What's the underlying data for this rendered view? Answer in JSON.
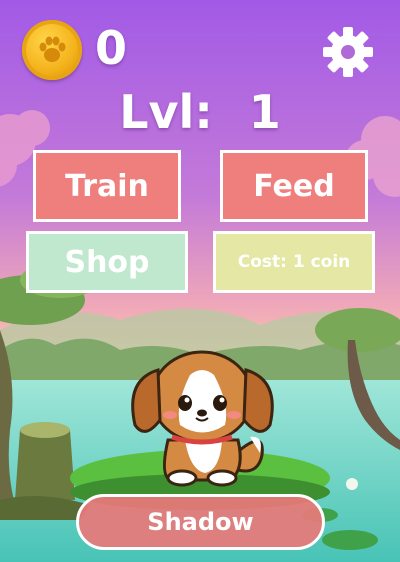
{
  "hud": {
    "coin_icon": "paw-coin-icon",
    "coins": "0",
    "settings_icon": "gear-icon"
  },
  "level": {
    "label": "Lvl:",
    "value": "1"
  },
  "buttons": {
    "train": "Train",
    "feed": "Feed",
    "shop": "Shop",
    "cost": "Cost: 1 coin"
  },
  "pet": {
    "name": "Shadow",
    "species_icon": "puppy-icon"
  },
  "colors": {
    "sky_top": "#a75ee0",
    "sky_mid": "#d884c8",
    "water": "#62d4c4",
    "primary_button": "#ef7f7d",
    "shop_button": "#bfe8cf",
    "cost_button": "#e4e8a4",
    "coin": "#f4b31c"
  }
}
